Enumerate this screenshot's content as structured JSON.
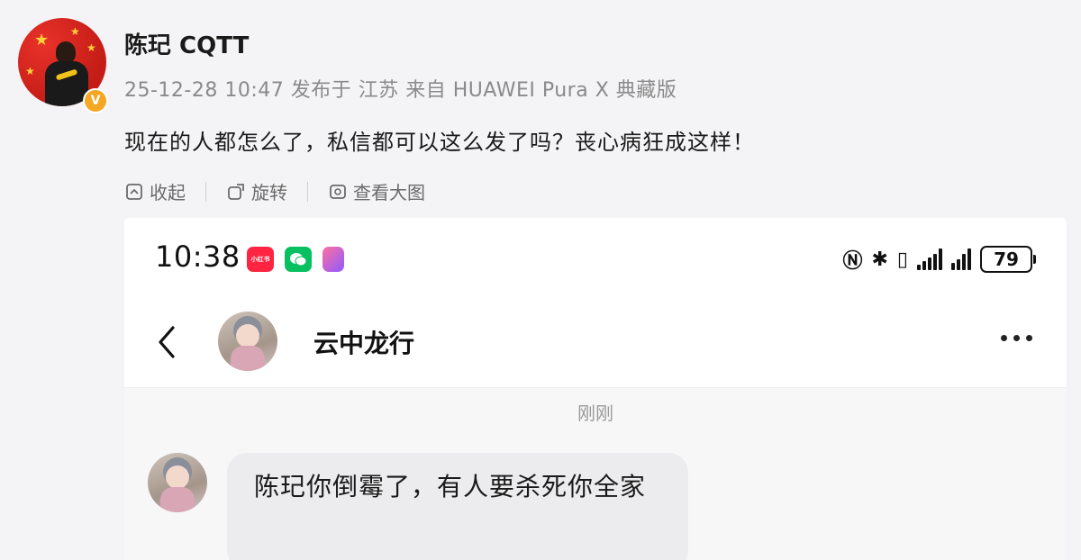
{
  "post": {
    "username": "陈玘 CQTT",
    "meta": "25-12-28 10:47 发布于 江苏 来自 HUAWEI Pura X 典藏版",
    "text": "现在的人都怎么了，私信都可以这么发了吗？丧心病狂成这样！",
    "actions": {
      "collapse": "收起",
      "rotate": "旋转",
      "view_large": "查看大图"
    }
  },
  "phone": {
    "status": {
      "time": "10:38",
      "app_badge_1": "小红书",
      "battery": "79"
    },
    "chat": {
      "contact_name": "云中龙行",
      "message_time": "刚刚",
      "message_text": "陈玘你倒霉了，有人要杀死你全家"
    }
  },
  "colors": {
    "accent_badge": "#f5a623",
    "avatar_red": "#c41c16",
    "bubble": "#ececee"
  }
}
